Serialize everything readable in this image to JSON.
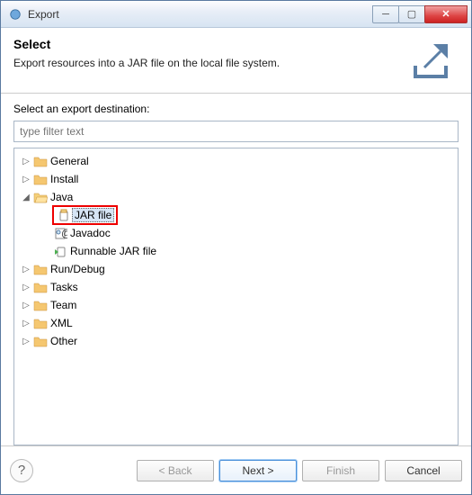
{
  "window": {
    "title": "Export"
  },
  "header": {
    "title": "Select",
    "description": "Export resources into a JAR file on the local file system."
  },
  "body": {
    "prompt": "Select an export destination:",
    "filter_placeholder": "type filter text"
  },
  "tree": {
    "general": "General",
    "install": "Install",
    "java": "Java",
    "jar_file": "JAR file",
    "javadoc": "Javadoc",
    "runnable_jar": "Runnable JAR file",
    "run_debug": "Run/Debug",
    "tasks": "Tasks",
    "team": "Team",
    "xml": "XML",
    "other": "Other"
  },
  "footer": {
    "back": "< Back",
    "next": "Next >",
    "finish": "Finish",
    "cancel": "Cancel"
  }
}
